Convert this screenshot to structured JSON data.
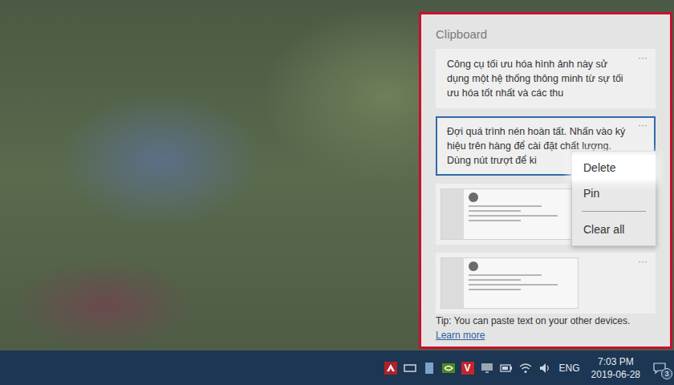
{
  "panel": {
    "title": "Clipboard",
    "tip": "Tip: You can paste text on your other devices.",
    "link": "Learn more"
  },
  "items": [
    {
      "kind": "text",
      "text": "Công cụ tối ưu hóa hình ảnh này sử dụng một hệ thống thông minh từ sự tối ưu hóa tốt nhất và các thu",
      "selected": false,
      "more": "···"
    },
    {
      "kind": "text",
      "text": "Đợi quá trình nén hoàn tất. Nhấn vào ký hiệu trên hàng để cài đặt chất lượng. Dùng nút trượt để ki",
      "selected": true,
      "more": "···"
    },
    {
      "kind": "image",
      "text": "",
      "selected": false,
      "more": "···"
    },
    {
      "kind": "image",
      "text": "",
      "selected": false,
      "more": "···"
    }
  ],
  "context_menu": {
    "items": [
      {
        "label": "Delete",
        "selected": true,
        "divider_above": false
      },
      {
        "label": "Pin",
        "selected": false,
        "divider_above": false
      },
      {
        "label": "Clear all",
        "selected": false,
        "divider_above": true
      }
    ]
  },
  "taskbar": {
    "vendor_badge": "V",
    "language": "ENG",
    "time": "7:03 PM",
    "date": "2019-06-28",
    "notifications": "3"
  }
}
